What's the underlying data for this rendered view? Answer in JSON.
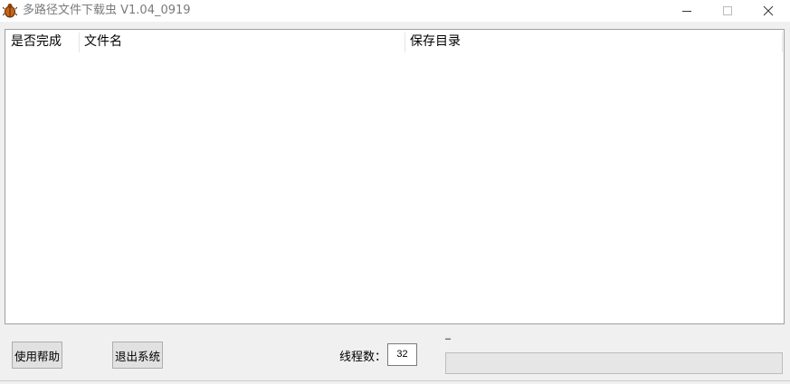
{
  "window": {
    "title": "多路径文件下载虫 V1.04_0919",
    "icon": "bug-icon",
    "controls": {
      "minimize": "−",
      "maximize": "☐",
      "close": "✕"
    }
  },
  "list": {
    "columns": [
      "是否完成",
      "文件名",
      "保存目录"
    ],
    "rows": []
  },
  "buttons": {
    "help": "使用帮助",
    "exit": "退出系统"
  },
  "threads": {
    "label": "线程数：",
    "value": "32"
  },
  "status": {
    "text": "–"
  },
  "progress": {
    "fraction": 0
  },
  "colors": {
    "icon_orange": "#c86414",
    "progress_fill": "#06b025"
  }
}
